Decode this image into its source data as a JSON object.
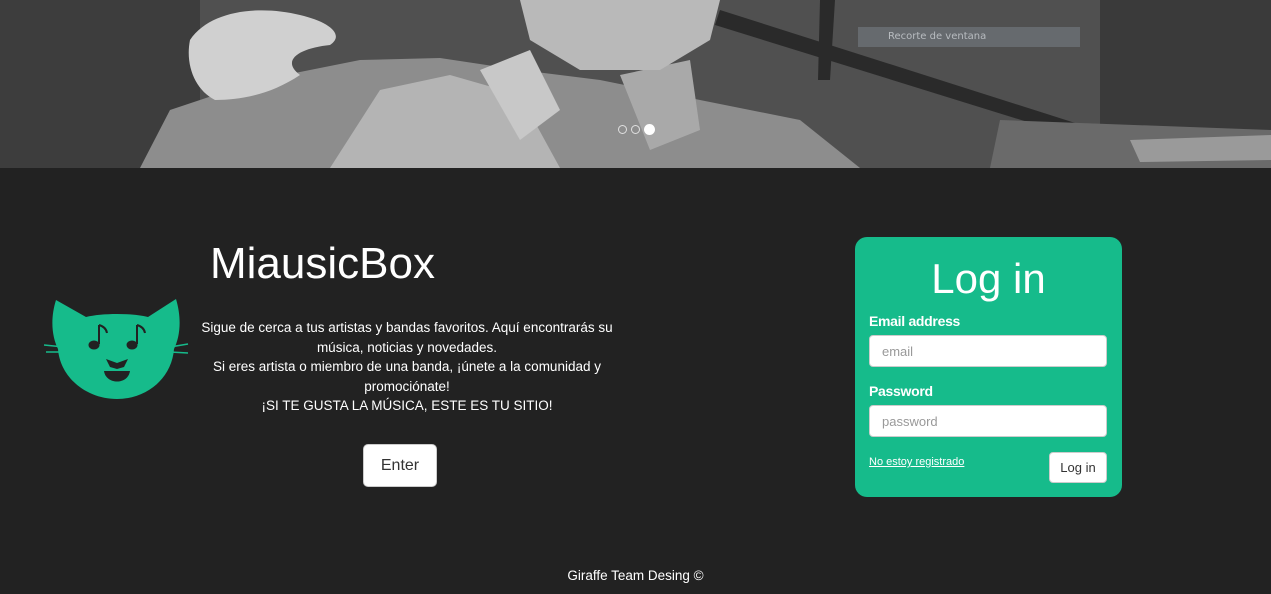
{
  "carousel": {
    "caption": "Recorte de ventana",
    "indicators": [
      false,
      false,
      true
    ]
  },
  "brand": {
    "title": "MiausicBox",
    "intro_lines": [
      "Sigue de cerca a tus artistas y bandas favoritos. Aquí encontrarás su música, noticias y novedades.",
      "Si eres artista o miembro de una banda, ¡únete a la comunidad y promociónate!",
      "¡SI TE GUSTA LA MÚSICA, ESTE ES TU SITIO!"
    ],
    "enter_label": "Enter",
    "accent_color": "#16bb8b"
  },
  "login": {
    "title": "Log in",
    "email_label": "Email address",
    "email_placeholder": "email",
    "email_value": "",
    "password_label": "Password",
    "password_placeholder": "password",
    "password_value": "",
    "register_link": "No estoy registrado",
    "submit_label": "Log in"
  },
  "footer": {
    "text": "Giraffe Team Desing ©"
  }
}
